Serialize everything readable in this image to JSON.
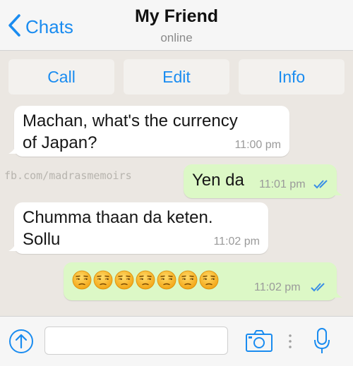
{
  "nav": {
    "back_label": "Chats",
    "title": "My Friend",
    "status": "online"
  },
  "actions": {
    "call": "Call",
    "edit": "Edit",
    "info": "Info"
  },
  "watermark": "fb.com/madrasmemoirs",
  "messages": [
    {
      "direction": "in",
      "lines": [
        "Machan, what's the currency",
        "of Japan?"
      ],
      "time": "11:00 pm"
    },
    {
      "direction": "out",
      "lines": [
        "Yen da"
      ],
      "time": "11:01 pm",
      "read": true
    },
    {
      "direction": "in",
      "lines": [
        "Chumma thaan da keten.",
        "Sollu"
      ],
      "time": "11:02 pm"
    },
    {
      "direction": "out",
      "emoji": "unamused-face",
      "emoji_count": 7,
      "time": "11:02 pm",
      "read": true
    }
  ],
  "input": {
    "value": "",
    "placeholder": ""
  },
  "colors": {
    "accent": "#1a8cf0",
    "outgoing": "#dcf8c6",
    "incoming": "#ffffff",
    "background": "#ebe7e2"
  },
  "icons": [
    "chevron-left-icon",
    "upload-arrow-icon",
    "camera-icon",
    "microphone-icon",
    "read-receipt-ticks-icon",
    "unamused-face-emoji"
  ]
}
